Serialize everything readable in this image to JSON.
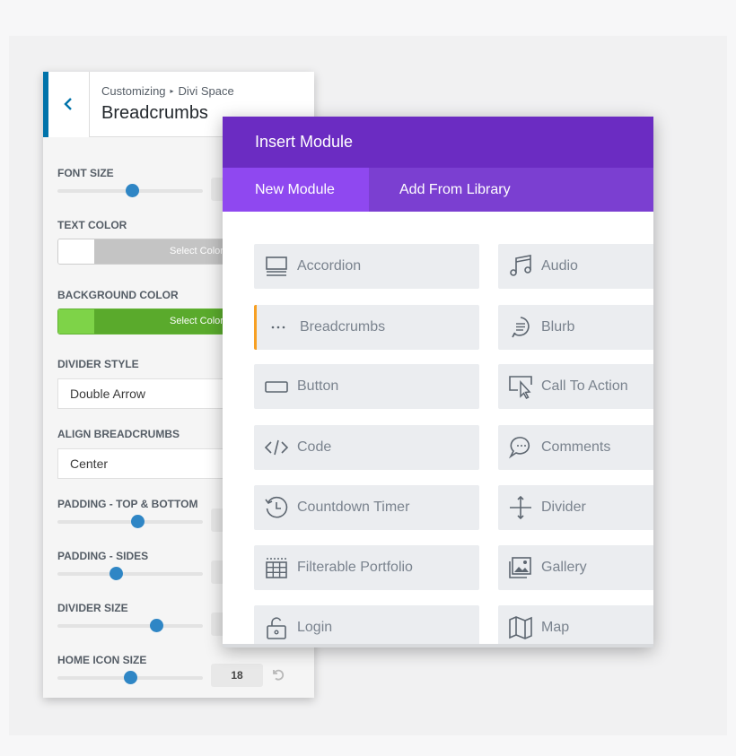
{
  "customizer": {
    "breadcrumb_root": "Customizing",
    "breadcrumb_separator": "▸",
    "breadcrumb_section": "Divi Space",
    "title": "Breadcrumbs",
    "font_size_label": "FONT SIZE",
    "font_size_level": 0.51,
    "text_color_label": "TEXT COLOR",
    "text_color_button": "Select Color",
    "text_color_value": "#ffffff",
    "background_color_label": "BACKGROUND COLOR",
    "background_color_button": "Select Color",
    "background_color_value": "#7ed348",
    "divider_style_label": "DIVIDER STYLE",
    "divider_style_value": "Double Arrow",
    "align_label": "ALIGN BREADCRUMBS",
    "align_value": "Center",
    "padding_tb_label": "PADDING - TOP & BOTTOM",
    "padding_tb_level": 0.55,
    "padding_sides_label": "PADDING - SIDES",
    "padding_sides_level": 0.4,
    "divider_size_label": "DIVIDER SIZE",
    "divider_size_level": 0.68,
    "home_icon_label": "HOME ICON SIZE",
    "home_icon_value": "18",
    "home_icon_level": 0.5,
    "accent_color": "#0073aa",
    "slider_color": "#2f86c5"
  },
  "modal": {
    "title": "Insert Module",
    "tab_new": "New Module",
    "tab_library": "Add From Library",
    "header_color": "#6b2cc2",
    "active_tab_color": "#8f48f0",
    "modules_left": [
      {
        "label": "Accordion",
        "icon": "accordion-icon"
      },
      {
        "label": "Breadcrumbs",
        "icon": "breadcrumbs-icon"
      },
      {
        "label": "Button",
        "icon": "button-icon"
      },
      {
        "label": "Code",
        "icon": "code-icon"
      },
      {
        "label": "Countdown Timer",
        "icon": "countdown-timer-icon"
      },
      {
        "label": "Filterable Portfolio",
        "icon": "filterable-portfolio-icon"
      },
      {
        "label": "Login",
        "icon": "login-icon"
      }
    ],
    "modules_right": [
      {
        "label": "Audio",
        "icon": "audio-icon"
      },
      {
        "label": "Blurb",
        "icon": "blurb-icon"
      },
      {
        "label": "Call To Action",
        "icon": "call-to-action-icon"
      },
      {
        "label": "Comments",
        "icon": "comments-icon"
      },
      {
        "label": "Divider",
        "icon": "divider-icon"
      },
      {
        "label": "Gallery",
        "icon": "gallery-icon"
      },
      {
        "label": "Map",
        "icon": "map-icon"
      }
    ]
  }
}
